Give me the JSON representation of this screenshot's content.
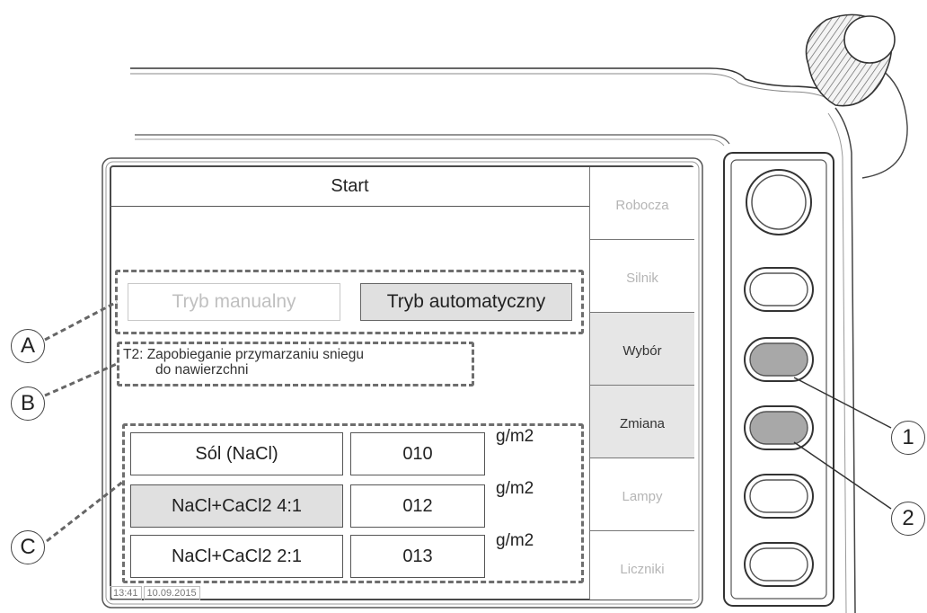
{
  "screen": {
    "title": "Start",
    "side_menu": [
      {
        "label": "Robocza",
        "active": false
      },
      {
        "label": "Silnik",
        "active": false
      },
      {
        "label": "Wybór",
        "active": true
      },
      {
        "label": "Zmiana",
        "active": true
      },
      {
        "label": "Lampy",
        "active": false
      },
      {
        "label": "Liczniki",
        "active": false
      }
    ],
    "modes": {
      "manual": "Tryb manualny",
      "automatic": "Tryb automatyczny"
    },
    "description": {
      "line1": "T2: Zapobieganie przymarzaniu sniegu",
      "line2": "do nawierzchni"
    },
    "materials": [
      {
        "name": "Sól (NaCl)",
        "value": "010",
        "unit": "g/m2",
        "selected": false
      },
      {
        "name": "NaCl+CaCl2 4:1",
        "value": "012",
        "unit": "g/m2",
        "selected": true
      },
      {
        "name": "NaCl+CaCl2 2:1",
        "value": "013",
        "unit": "g/m2",
        "selected": false
      }
    ],
    "status": {
      "time": "13:41",
      "date": "10.09.2015"
    }
  },
  "callouts": {
    "a": "A",
    "b": "B",
    "c": "C",
    "one": "1",
    "two": "2"
  }
}
